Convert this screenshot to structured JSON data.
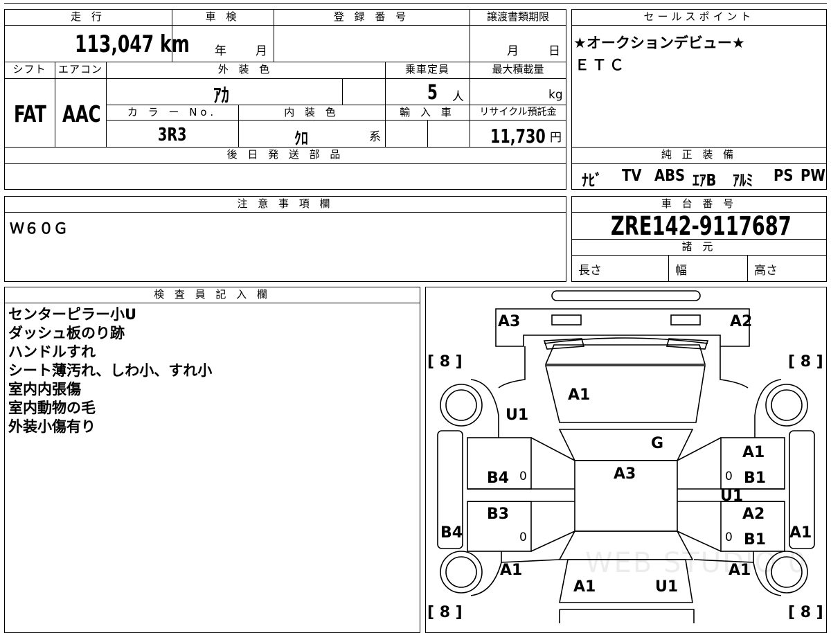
{
  "vehicle": {
    "mileage_label": "走 行",
    "mileage": "113,047 km",
    "inspection_label": "車 検",
    "inspection_year_unit": "年",
    "inspection_month_unit": "月",
    "registration_label": "登 録 番 号",
    "transfer_deadline_label": "譲渡書類期限",
    "transfer_month_unit": "月",
    "transfer_day_unit": "日",
    "shift_label": "シフト",
    "shift": "FAT",
    "aircon_label": "エアコン",
    "aircon": "AAC",
    "exterior_color_label": "外 装 色",
    "exterior_color": "ｱｶ",
    "color_no_label": "カ ラ ー No.",
    "color_no": "3R3",
    "interior_color_label": "内 装 色",
    "interior_color": "ｸﾛ",
    "interior_color_suffix": "系",
    "capacity_label": "乗車定員",
    "capacity": "5",
    "capacity_unit": "人",
    "import_label": "輸 入 車",
    "max_load_label": "最大積載量",
    "max_load_unit": "kg",
    "recycle_label": "リサイクル預託金",
    "recycle_fee": "11,730",
    "recycle_unit": "円",
    "later_parts_label": "後 日 発 送 部 品"
  },
  "sales_points": {
    "label": "セールスポイント",
    "lines": [
      "★オークションデビュー★",
      "ＥＴＣ"
    ]
  },
  "equipment": {
    "label": "純 正 装 備",
    "items": [
      "ﾅﾋﾞ",
      "TV",
      "ABS",
      "ｴｱB",
      "ｱﾙﾐ",
      "PS",
      "PW"
    ]
  },
  "notes": {
    "label": "注 意 事 項 欄",
    "text": "Ｗ６０Ｇ"
  },
  "chassis": {
    "label": "車 台 番 号",
    "number": "ZRE142-9117687",
    "specs_label": "諸 元",
    "length_label": "長さ",
    "width_label": "幅",
    "height_label": "高さ"
  },
  "inspector": {
    "label": "検 査 員 記 入 欄",
    "lines": [
      "センターピラー小U",
      "ダッシュ板のり跡",
      "ハンドルすれ",
      "シート薄汚れ、しわ小、すれ小",
      "室内内張傷",
      "室内動物の毛",
      "外装小傷有り"
    ]
  },
  "damage_map": {
    "tire_tread_marks": [
      "[ 8 ]",
      "[ 8 ]",
      "[ 8 ]",
      "[ 8 ]"
    ],
    "codes": {
      "rear_left_corner": "A3",
      "rear_right_corner": "A2",
      "rear_glass": "A1",
      "left_rear_fender": "U1",
      "roof_right": "G",
      "roof": "A3",
      "right_rear_door_top": "A1",
      "right_rear_door": "B1",
      "right_pillar": "U1",
      "right_front_door_top": "A2",
      "right_front_door": "B1",
      "right_sill": "A1",
      "left_rear_door": "B4",
      "left_front_door": "B3",
      "left_sill": "B4",
      "left_front_fender": "A1",
      "right_front_fender": "A1",
      "hood_left": "A1",
      "hood_right": "U1"
    },
    "zero_marks": [
      "0",
      "0",
      "0",
      "0"
    ]
  },
  "watermark": "WEB STUDIO 0"
}
